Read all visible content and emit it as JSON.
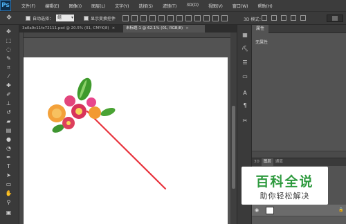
{
  "app": {
    "logo": "Ps"
  },
  "menu": [
    "文件(F)",
    "编辑(E)",
    "图像(I)",
    "图层(L)",
    "文字(Y)",
    "选择(S)",
    "滤镜(T)",
    "3D(D)",
    "视图(V)",
    "窗口(W)",
    "帮助(H)"
  ],
  "options": {
    "auto_select_label": "自动选择：",
    "auto_select_value": "组",
    "show_transform_label": "显示变换控件",
    "mode_3d_label": "3D 模式："
  },
  "tabs": [
    {
      "label": "3a0a9c11fe72111.psd @ 20.5% (01, CMYK/8)",
      "close": "×",
      "active": false
    },
    {
      "label": "未标题-1 @ 62.1% (01, RGB/8)",
      "close": "×",
      "active": true
    }
  ],
  "panels": {
    "properties": {
      "tab": "属性",
      "message": "无属性"
    },
    "layers": {
      "tabs": [
        "3D",
        "图层",
        "通道"
      ]
    }
  },
  "watermark": {
    "title": "百科全说",
    "subtitle": "助你轻松解决"
  },
  "colors": {
    "menubar": "#3c3c3c",
    "panel": "#535353",
    "watermark_green": "#2e9a3e",
    "stem_red": "#e8323c"
  }
}
